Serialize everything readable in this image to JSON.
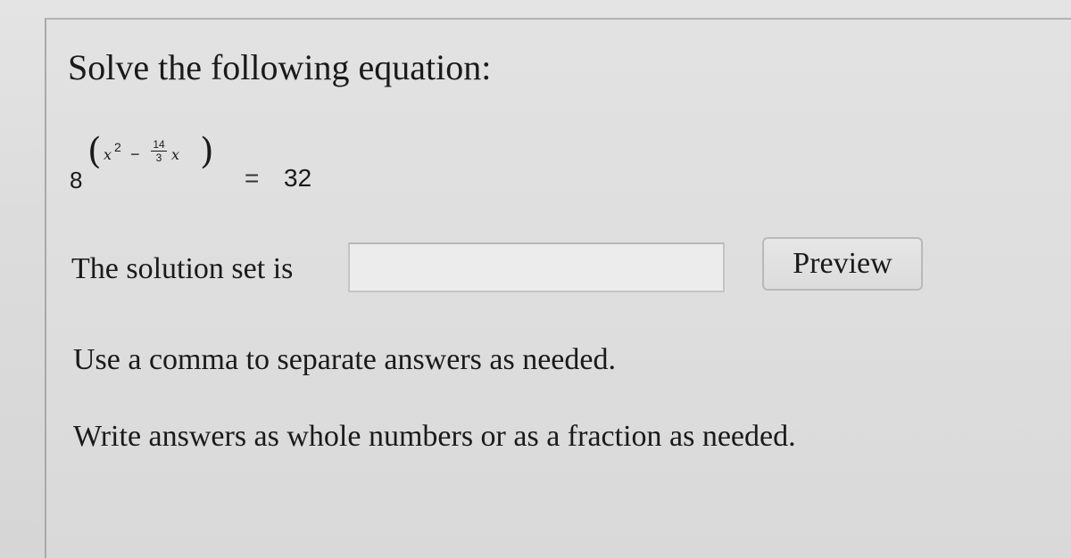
{
  "question": {
    "title": "Solve the following equation:",
    "equation": {
      "base": "8",
      "exponent_variable": "x",
      "exponent_power": "2",
      "exponent_operator": "−",
      "fraction_numerator": "14",
      "fraction_denominator": "3",
      "exponent_variable_2": "x",
      "equals_sign": "=",
      "right_hand_side": "32"
    },
    "answer": {
      "label": "The solution set is",
      "value": "",
      "placeholder": ""
    },
    "preview_button_label": "Preview",
    "instructions": [
      "Use a comma to separate answers as needed.",
      "Write answers as whole numbers or as a fraction as needed."
    ]
  }
}
